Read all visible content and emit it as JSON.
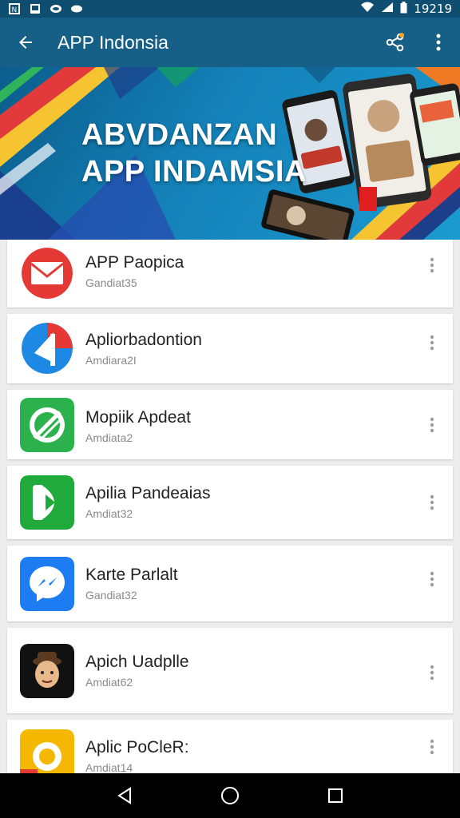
{
  "status_bar": {
    "time": "19219",
    "icons": [
      "notification-icon",
      "photo-icon",
      "cast-icon",
      "cloud-icon",
      "wifi-icon",
      "signal-icon",
      "battery-icon"
    ]
  },
  "app_bar": {
    "title": "APP Indonsia",
    "background": "#165f86",
    "status_background": "#0f4e70",
    "share_badge_color": "#f5a623"
  },
  "banner": {
    "line1": "ABVDANZAN",
    "line2": "APP INDAMSIA"
  },
  "apps": [
    {
      "name": "APP Paopica",
      "sub": "Gandiat35",
      "icon": "mail-icon",
      "color": "#e53935"
    },
    {
      "name": "Apliorbadontion",
      "sub": "Amdiara2I",
      "icon": "arrow-icon",
      "color": "#1e88e5"
    },
    {
      "name": "Mopiik Apdeat",
      "sub": "Amdiata2",
      "icon": "leaf-icon",
      "color": "#2bb24c"
    },
    {
      "name": "Apilia Pandeaias",
      "sub": "Amdiat32",
      "icon": "play-icon",
      "color": "#1faa3b"
    },
    {
      "name": "Karte Parlalt",
      "sub": "Gandiat32",
      "icon": "messenger-icon",
      "color": "#1e7cf2"
    },
    {
      "name": "Apich Uadplle",
      "sub": "Amdiat62",
      "icon": "avatar-icon",
      "color": "#111111"
    },
    {
      "name": "Aplic PoCleR:",
      "sub": "Amdiat14",
      "icon": "camera-icon",
      "color": "#f5b800"
    }
  ],
  "nav_bar": {
    "items": [
      "back-icon",
      "home-icon",
      "recents-icon"
    ]
  }
}
